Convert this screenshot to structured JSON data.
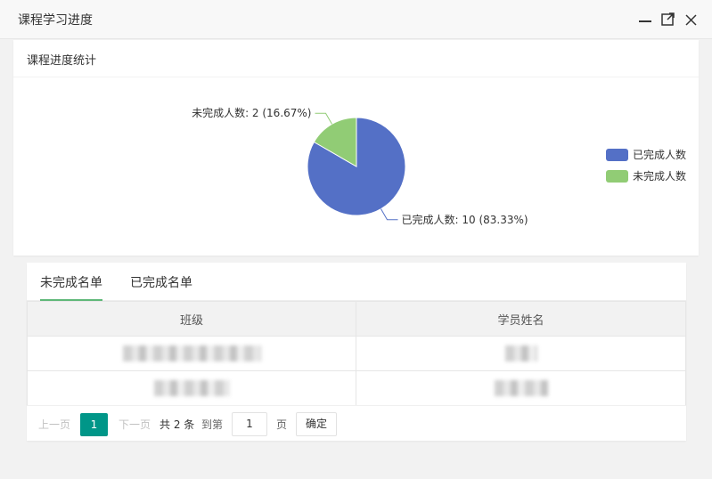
{
  "window": {
    "title": "课程学习进度"
  },
  "stats_card": {
    "title": "课程进度统计"
  },
  "chart_data": {
    "type": "pie",
    "categories": [
      "已完成人数",
      "未完成人数"
    ],
    "values": [
      10,
      2
    ],
    "slice_labels": [
      "已完成人数: 10 (83.33%)",
      "未完成人数: 2 (16.67%)"
    ],
    "colors": [
      "#5470C6",
      "#91CC75"
    ],
    "legend": [
      "已完成人数",
      "未完成人数"
    ],
    "legend_position": "right"
  },
  "tabs": [
    {
      "label": "未完成名单",
      "active": true
    },
    {
      "label": "已完成名单",
      "active": false
    }
  ],
  "table": {
    "columns": [
      "班级",
      "学员姓名"
    ],
    "rows": [
      {
        "class": "",
        "name": ""
      },
      {
        "class": "",
        "name": ""
      }
    ]
  },
  "pager": {
    "prev": "上一页",
    "current": "1",
    "next": "下一页",
    "total": "共 2 条",
    "goto_label": "到第",
    "goto_value": "1",
    "page_unit": "页",
    "confirm": "确定"
  }
}
